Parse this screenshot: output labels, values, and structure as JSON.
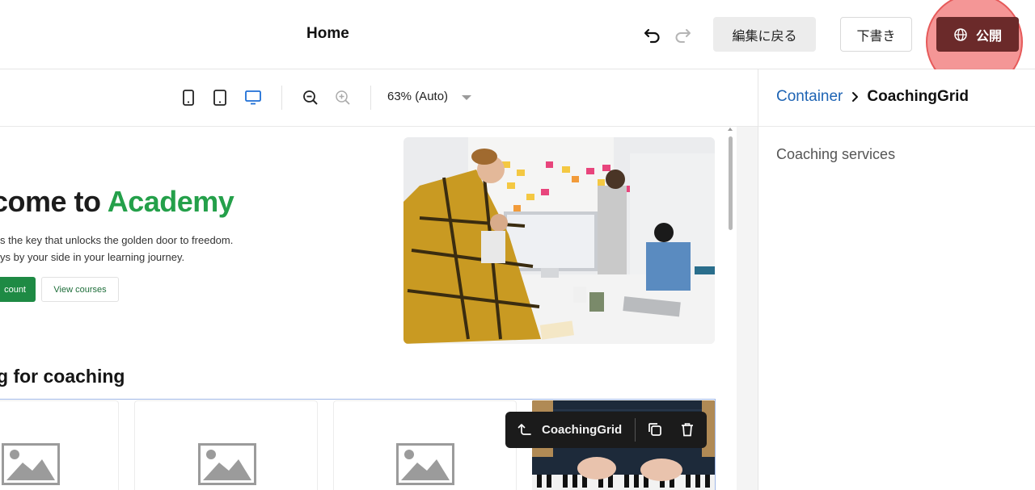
{
  "header": {
    "title": "Home",
    "back_to_edit_label": "編集に戻る",
    "draft_label": "下書き",
    "publish_label": "公開"
  },
  "toolbar": {
    "zoom_label": "63% (Auto)"
  },
  "preview": {
    "hero_title_plain": "come to ",
    "hero_title_accent": "Academy",
    "hero_line_1": "s the key that unlocks the golden door to freedom.",
    "hero_line_2": "ys by your side in your learning journey.",
    "primary_button_label": "count",
    "secondary_button_label": "View courses",
    "section_title": "g for coaching"
  },
  "component_toolbar": {
    "name": "CoachingGrid"
  },
  "right_panel": {
    "breadcrumb_parent": "Container",
    "breadcrumb_current": "CoachingGrid",
    "section_label": "Coaching services"
  },
  "colors": {
    "publish": "#6b2a2a",
    "accent_green": "#24a04a",
    "link_blue": "#1e64b4"
  }
}
